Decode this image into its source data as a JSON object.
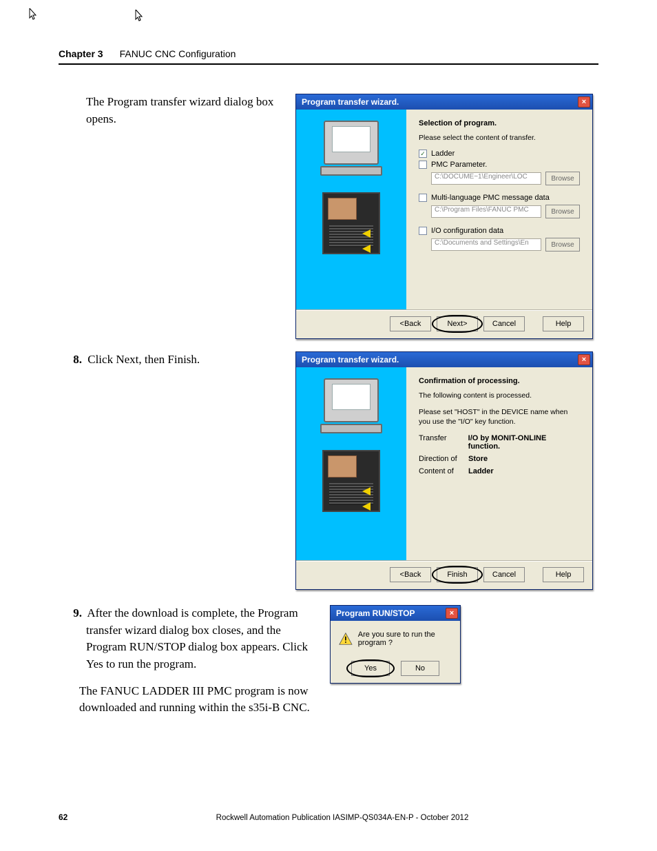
{
  "header": {
    "chapter_label": "Chapter 3",
    "chapter_title": "FANUC CNC Configuration"
  },
  "para_open": "The Program transfer wizard dialog box opens.",
  "step8": {
    "num": "8.",
    "text": "Click Next, then Finish."
  },
  "step9": {
    "num": "9.",
    "text": "After the download is complete, the Program transfer wizard dialog box closes, and the Program RUN/STOP dialog box appears. Click Yes to run the program."
  },
  "para_final": "The FANUC LADDER III PMC program is now downloaded and running within the s35i-B CNC.",
  "dialog1": {
    "title": "Program transfer wizard.",
    "heading": "Selection of program.",
    "subtext": "Please select the content of transfer.",
    "opt_ladder": "Ladder",
    "opt_pmc_param": "PMC Parameter.",
    "path_pmc_param": "C:\\DOCUME~1\\Engineer\\LOC",
    "opt_multi": "Multi-language PMC message data",
    "path_multi": "C:\\Program Files\\FANUC PMC",
    "opt_io": "I/O configuration data",
    "path_io": "C:\\Documents and Settings\\En",
    "browse": "Browse",
    "back": "<Back",
    "next": "Next>",
    "cancel": "Cancel",
    "help": "Help"
  },
  "dialog2": {
    "title": "Program transfer wizard.",
    "heading": "Confirmation of processing.",
    "line1": "The following content is processed.",
    "line2": "Please set \"HOST\" in the DEVICE name when you use the \"I/O\" key function.",
    "transfer_k": "Transfer",
    "transfer_v": "I/O by MONIT-ONLINE function.",
    "direction_k": "Direction of",
    "direction_v": "Store",
    "content_k": "Content of",
    "content_v": "Ladder",
    "back": "<Back",
    "finish": "Finish",
    "cancel": "Cancel",
    "help": "Help"
  },
  "dialog3": {
    "title": "Program RUN/STOP",
    "msg": "Are you sure to run the program ?",
    "yes": "Yes",
    "no": "No"
  },
  "footer": {
    "page": "62",
    "pub_a": "Rockwell Automation Publication IASIMP-QS034A-EN-P - ",
    "pub_b": "October 2012"
  }
}
